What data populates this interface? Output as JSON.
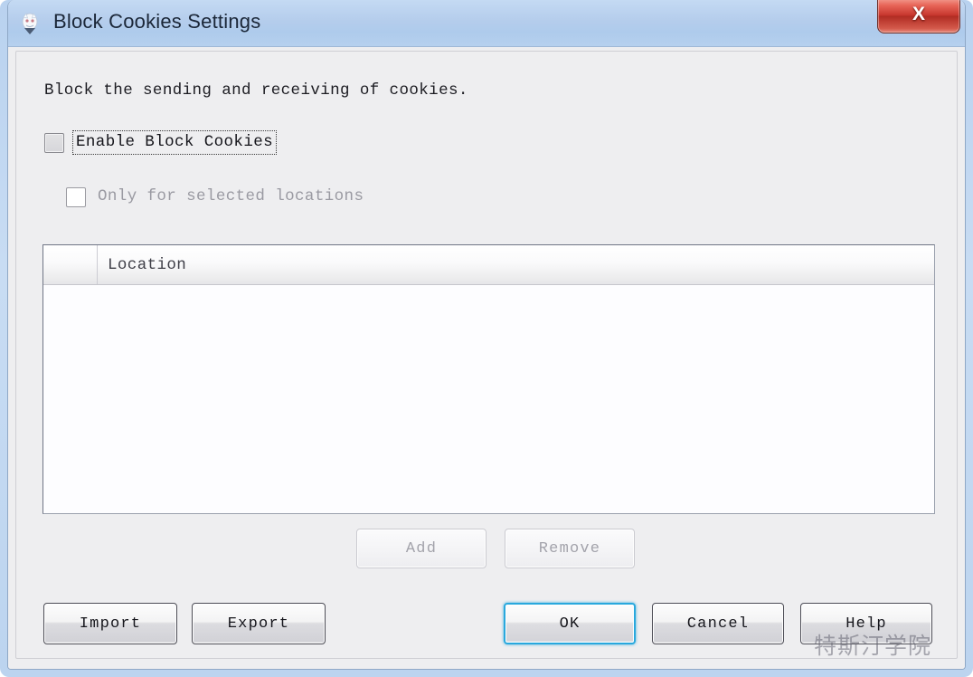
{
  "window": {
    "title": "Block Cookies Settings",
    "app_icon": "app-icon",
    "close_label": "X",
    "accent_blue": "#29a8dd",
    "titlebar_color": "#aecbec",
    "close_button_color": "#c6352c",
    "content_background": "#eeeef0"
  },
  "content": {
    "description": "Block the sending and receiving of cookies.",
    "checkboxes": [
      {
        "label": "Enable Block Cookies",
        "checked": false,
        "enabled": true,
        "focused": true
      },
      {
        "label": "Only for selected locations",
        "checked": false,
        "enabled": false,
        "focused": false
      }
    ]
  },
  "locations_table": {
    "columns": [
      "",
      "Location"
    ],
    "rows": []
  },
  "list_buttons": [
    {
      "label": "Add",
      "enabled": false
    },
    {
      "label": "Remove",
      "enabled": false
    }
  ],
  "dialog_buttons": [
    {
      "label": "Import",
      "enabled": true,
      "default": false
    },
    {
      "label": "Export",
      "enabled": true,
      "default": false
    },
    {
      "label": "OK",
      "enabled": true,
      "default": true
    },
    {
      "label": "Cancel",
      "enabled": true,
      "default": false
    },
    {
      "label": "Help",
      "enabled": true,
      "default": false
    }
  ],
  "watermark": {
    "text": "特斯汀学院"
  }
}
